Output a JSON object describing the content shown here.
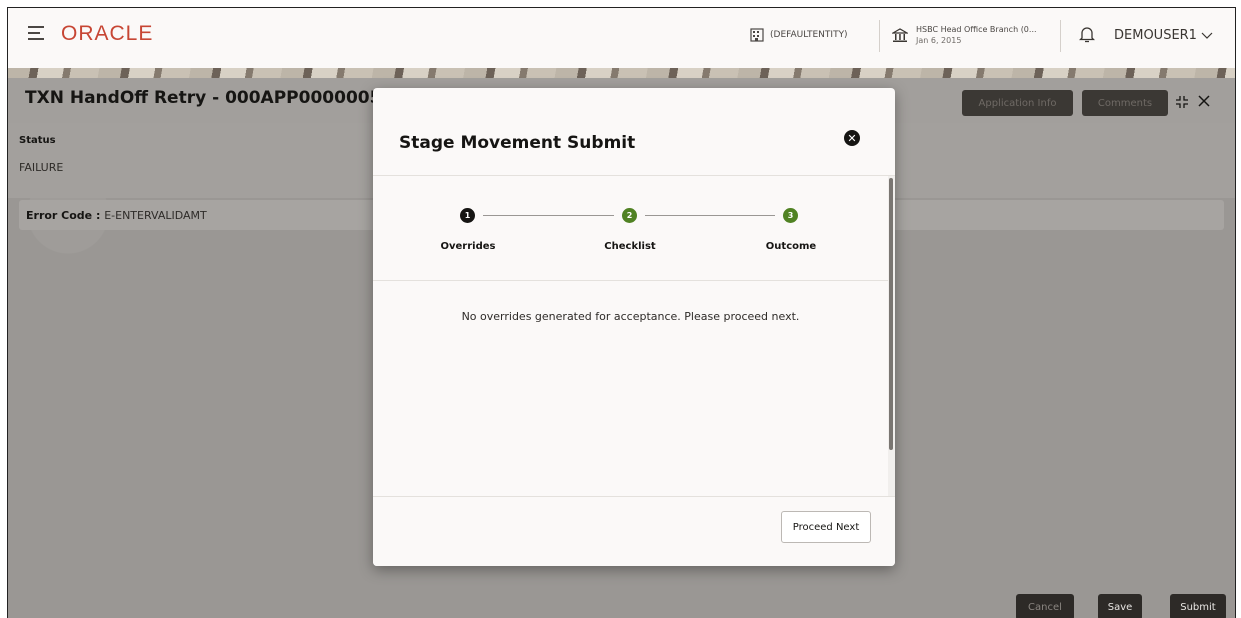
{
  "header": {
    "logo": "ORACLE",
    "entity": "(DEFAULTENTITY)",
    "branch_name": "HSBC Head Office Branch (0...",
    "branch_date": "Jan 6, 2015",
    "user": "DEMOUSER1"
  },
  "page": {
    "title": "TXN HandOff Retry - 000APP0000005",
    "application_info_label": "Application Info",
    "comments_label": "Comments",
    "status_label": "Status",
    "status_value": "FAILURE",
    "error_code_label": "Error Code",
    "error_code_separator": " : ",
    "error_code_value": "E-ENTERVALIDAMT"
  },
  "footer": {
    "cancel_label": "Cancel",
    "save_label": "Save",
    "submit_label": "Submit"
  },
  "modal": {
    "title": "Stage Movement Submit",
    "steps": [
      {
        "number": "1",
        "label": "Overrides"
      },
      {
        "number": "2",
        "label": "Checklist"
      },
      {
        "number": "3",
        "label": "Outcome"
      }
    ],
    "message": "No overrides generated for acceptance. Please proceed next.",
    "proceed_label": "Proceed Next"
  },
  "colors": {
    "brand": "#c74634",
    "step_complete": "#508223",
    "step_current": "#161513"
  }
}
